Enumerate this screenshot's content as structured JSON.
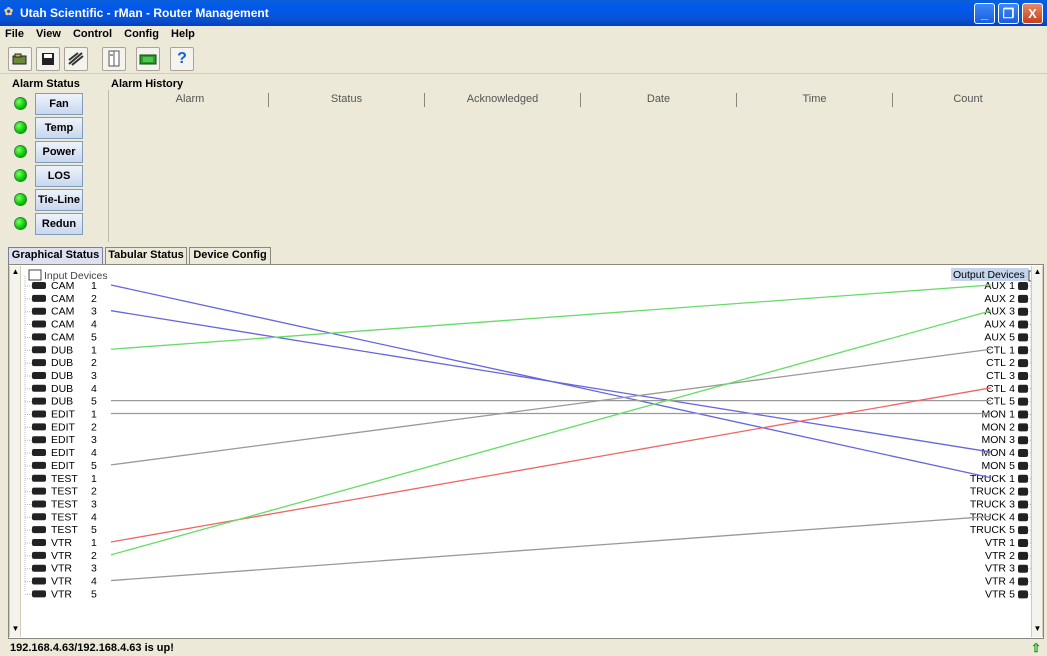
{
  "window": {
    "title": "Utah Scientific - rMan - Router Management",
    "buttons": [
      "_",
      "❐",
      "X"
    ]
  },
  "menu": [
    "File",
    "View",
    "Control",
    "Config",
    "Help"
  ],
  "toolbar": {
    "icons": [
      "open-icon",
      "save-icon",
      "disconnect-icon",
      "config-icon",
      "display-icon",
      "help-icon"
    ]
  },
  "alarm_status": {
    "title": "Alarm Status",
    "items": [
      {
        "label": "Fan",
        "state": "ok"
      },
      {
        "label": "Temp",
        "state": "ok"
      },
      {
        "label": "Power",
        "state": "ok"
      },
      {
        "label": "LOS",
        "state": "ok"
      },
      {
        "label": "Tie-Line",
        "state": "ok"
      },
      {
        "label": "Redun",
        "state": "ok"
      }
    ]
  },
  "alarm_history": {
    "title": "Alarm History",
    "columns": [
      "Alarm",
      "Status",
      "Acknowledged",
      "Date",
      "Time",
      "Count"
    ],
    "rows": []
  },
  "tabs": [
    {
      "label": "Graphical Status",
      "active": true
    },
    {
      "label": "Tabular Status",
      "active": false
    },
    {
      "label": "Device Config",
      "active": false
    }
  ],
  "graphical": {
    "input_header": "Input Devices",
    "output_header": "Output Devices",
    "inputs": [
      {
        "name": "CAM",
        "num": "1"
      },
      {
        "name": "CAM",
        "num": "2"
      },
      {
        "name": "CAM",
        "num": "3"
      },
      {
        "name": "CAM",
        "num": "4"
      },
      {
        "name": "CAM",
        "num": "5"
      },
      {
        "name": "DUB",
        "num": "1"
      },
      {
        "name": "DUB",
        "num": "2"
      },
      {
        "name": "DUB",
        "num": "3"
      },
      {
        "name": "DUB",
        "num": "4"
      },
      {
        "name": "DUB",
        "num": "5"
      },
      {
        "name": "EDIT",
        "num": "1"
      },
      {
        "name": "EDIT",
        "num": "2"
      },
      {
        "name": "EDIT",
        "num": "3"
      },
      {
        "name": "EDIT",
        "num": "4"
      },
      {
        "name": "EDIT",
        "num": "5"
      },
      {
        "name": "TEST",
        "num": "1"
      },
      {
        "name": "TEST",
        "num": "2"
      },
      {
        "name": "TEST",
        "num": "3"
      },
      {
        "name": "TEST",
        "num": "4"
      },
      {
        "name": "TEST",
        "num": "5"
      },
      {
        "name": "VTR",
        "num": "1"
      },
      {
        "name": "VTR",
        "num": "2"
      },
      {
        "name": "VTR",
        "num": "3"
      },
      {
        "name": "VTR",
        "num": "4"
      },
      {
        "name": "VTR",
        "num": "5"
      }
    ],
    "outputs": [
      {
        "name": "AUX",
        "num": "1"
      },
      {
        "name": "AUX",
        "num": "2"
      },
      {
        "name": "AUX",
        "num": "3"
      },
      {
        "name": "AUX",
        "num": "4"
      },
      {
        "name": "AUX",
        "num": "5"
      },
      {
        "name": "CTL",
        "num": "1"
      },
      {
        "name": "CTL",
        "num": "2"
      },
      {
        "name": "CTL",
        "num": "3"
      },
      {
        "name": "CTL",
        "num": "4"
      },
      {
        "name": "CTL",
        "num": "5"
      },
      {
        "name": "MON",
        "num": "1"
      },
      {
        "name": "MON",
        "num": "2"
      },
      {
        "name": "MON",
        "num": "3"
      },
      {
        "name": "MON",
        "num": "4"
      },
      {
        "name": "MON",
        "num": "5"
      },
      {
        "name": "TRUCK",
        "num": "1"
      },
      {
        "name": "TRUCK",
        "num": "2"
      },
      {
        "name": "TRUCK",
        "num": "3"
      },
      {
        "name": "TRUCK",
        "num": "4"
      },
      {
        "name": "TRUCK",
        "num": "5"
      },
      {
        "name": "VTR",
        "num": "1"
      },
      {
        "name": "VTR",
        "num": "2"
      },
      {
        "name": "VTR",
        "num": "3"
      },
      {
        "name": "VTR",
        "num": "4"
      },
      {
        "name": "VTR",
        "num": "5"
      }
    ],
    "routes": [
      {
        "input": 0,
        "output": 15,
        "color": "#6666dd"
      },
      {
        "input": 2,
        "output": 13,
        "color": "#6666dd"
      },
      {
        "input": 5,
        "output": 0,
        "color": "#66dd66"
      },
      {
        "input": 9,
        "output": 9,
        "color": "#999999"
      },
      {
        "input": 10,
        "output": 10,
        "color": "#999999"
      },
      {
        "input": 14,
        "output": 5,
        "color": "#999999"
      },
      {
        "input": 20,
        "output": 8,
        "color": "#ee6666"
      },
      {
        "input": 21,
        "output": 2,
        "color": "#66dd66"
      },
      {
        "input": 23,
        "output": 18,
        "color": "#999999"
      }
    ]
  },
  "status": {
    "text": "192.168.4.63/192.168.4.63 is up!"
  }
}
